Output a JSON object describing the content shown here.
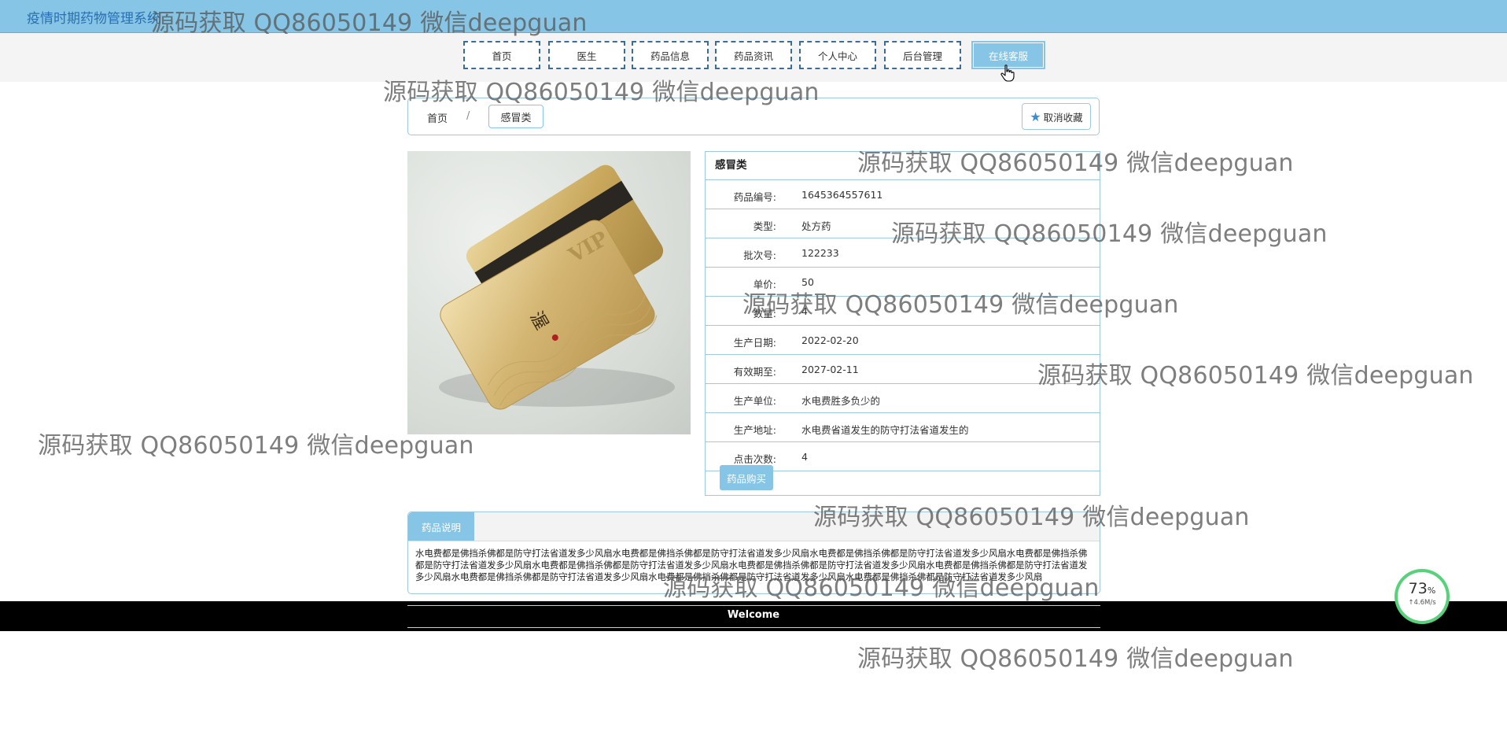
{
  "header": {
    "app_title": "疫情时期药物管理系统"
  },
  "nav": {
    "items": [
      {
        "label": "首页"
      },
      {
        "label": "医生"
      },
      {
        "label": "药品信息"
      },
      {
        "label": "药品资讯"
      },
      {
        "label": "个人中心"
      },
      {
        "label": "后台管理"
      },
      {
        "label": "在线客服",
        "active": true
      }
    ]
  },
  "breadcrumb": {
    "home": "首页",
    "separator": "/",
    "current": "感冒类",
    "favorite_label": "取消收藏"
  },
  "detail": {
    "header": "感冒类",
    "fields": [
      {
        "key": "药品编号:",
        "value": "1645364557611"
      },
      {
        "key": "类型:",
        "value": "处方药"
      },
      {
        "key": "批次号:",
        "value": "122233"
      },
      {
        "key": "单价:",
        "value": "50"
      },
      {
        "key": "数量:",
        "value": "4"
      },
      {
        "key": "生产日期:",
        "value": "2022-02-20"
      },
      {
        "key": "有效期至:",
        "value": "2027-02-11"
      },
      {
        "key": "生产单位:",
        "value": "水电费胜多负少的"
      },
      {
        "key": "生产地址:",
        "value": "水电费省道发生的防守打法省道发生的"
      },
      {
        "key": "点击次数:",
        "value": "4"
      }
    ],
    "buy_label": "药品购买"
  },
  "description": {
    "tab_label": "药品说明",
    "text": "水电费都是佛挡杀佛都是防守打法省道发多少风扇水电费都是佛挡杀佛都是防守打法省道发多少风扇水电费都是佛挡杀佛都是防守打法省道发多少风扇水电费都是佛挡杀佛都是防守打法省道发多少风扇水电费都是佛挡杀佛都是防守打法省道发多少风扇水电费都是佛挡杀佛都是防守打法省道发多少风扇水电费都是佛挡杀佛都是防守打法省道发多少风扇水电费都是佛挡杀佛都是防守打法省道发多少风扇水电费都是佛挡杀佛都是防守打法省道发多少风扇水电费都是佛挡杀佛都是防守打法省道发多少风扇"
  },
  "footer": {
    "welcome": "Welcome"
  },
  "speed_widget": {
    "percent": "73",
    "percent_unit": "%",
    "rate": "↑4.6M/s"
  },
  "watermark": {
    "text": "源码获取 QQ86050149 微信deepguan"
  },
  "colors": {
    "accent": "#86c5e5",
    "nav_border": "#3a6d9a",
    "footer_bg": "#000000"
  },
  "icons": {
    "favorite": "star-icon",
    "cursor": "hand-pointer-icon"
  }
}
